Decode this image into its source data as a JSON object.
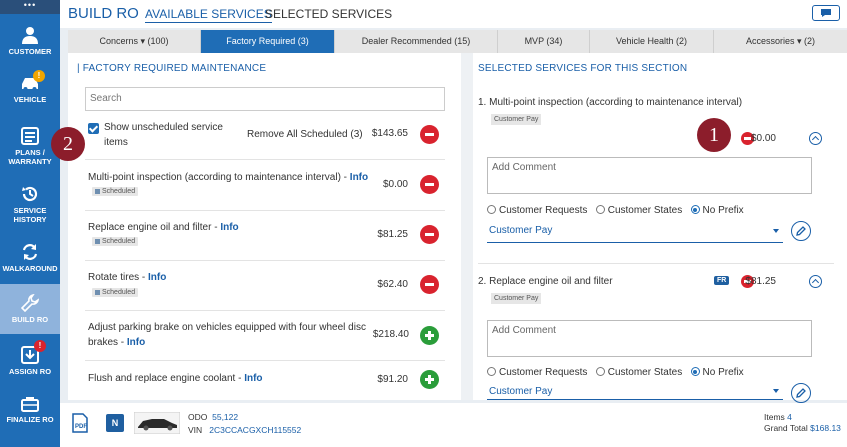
{
  "sidebar": {
    "top": "•••",
    "items": [
      {
        "label": "CUSTOMER"
      },
      {
        "label": "VEHICLE",
        "badge": "!"
      },
      {
        "label": "PLANS / WARRANTY"
      },
      {
        "label": "SERVICE HISTORY"
      },
      {
        "label": "WALKAROUND"
      },
      {
        "label": "BUILD RO"
      },
      {
        "label": "ASSIGN RO",
        "badge": "!"
      },
      {
        "label": "FINALIZE RO"
      }
    ]
  },
  "header": {
    "title": "BUILD RO",
    "tab_available": "AVAILABLE SERVICES",
    "tab_selected": "SELECTED SERVICES"
  },
  "tabs": [
    {
      "label": "Concerns ▾ (100)"
    },
    {
      "label": "Factory Required (3)"
    },
    {
      "label": "Dealer Recommended (15)"
    },
    {
      "label": "MVP (34)"
    },
    {
      "label": "Vehicle Health (2)"
    },
    {
      "label": "Accessories ▾ (2)"
    }
  ],
  "left_panel": {
    "title": "| FACTORY REQUIRED MAINTENANCE",
    "search_placeholder": "Search",
    "show_unscheduled": "Show unscheduled service items",
    "remove_all": "Remove All Scheduled (3)",
    "remove_all_price": "$143.65",
    "services": [
      {
        "name": "Multi-point inspection (according to maintenance interval) -",
        "info": "Info",
        "price": "$0.00",
        "tag": "Scheduled",
        "action": "remove"
      },
      {
        "name": "Replace engine oil and filter -",
        "info": "Info",
        "price": "$81.25",
        "tag": "Scheduled",
        "action": "remove"
      },
      {
        "name": "Rotate tires -",
        "info": "Info",
        "price": "$62.40",
        "tag": "Scheduled",
        "action": "remove"
      },
      {
        "name": "Adjust parking brake on vehicles equipped with four wheel disc brakes -",
        "info": "Info",
        "price": "$218.40",
        "tag": "",
        "action": "add"
      },
      {
        "name": "Flush and replace engine coolant -",
        "info": "Info",
        "price": "$91.20",
        "tag": "",
        "action": "add"
      }
    ]
  },
  "right_panel": {
    "title": "SELECTED SERVICES FOR THIS SECTION",
    "items": [
      {
        "title": "1.  Multi-point inspection (according to maintenance interval)",
        "pay_tag": "Customer Pay",
        "price": "$0.00",
        "comment_placeholder": "Add Comment",
        "radio_options": [
          "Customer Requests",
          "Customer States",
          "No Prefix"
        ],
        "pay_select": "Customer Pay"
      },
      {
        "title": "2.  Replace engine oil and filter",
        "badge": "FR",
        "pay_tag": "Customer Pay",
        "price": "$81.25",
        "comment_placeholder": "Add Comment",
        "radio_options": [
          "Customer Requests",
          "Customer States",
          "No Prefix"
        ],
        "pay_select": "Customer Pay"
      }
    ]
  },
  "callouts": [
    "1",
    "2"
  ],
  "footer": {
    "pdf": "PDF",
    "n_badge": "N",
    "odo_label": "ODO",
    "odo": "55,122",
    "vin_label": "VIN",
    "vin": "2C3CCACGXCH115552",
    "items_label": "Items",
    "items": "4",
    "grand_total_label": "Grand Total",
    "grand_total": "$168.13"
  },
  "colors": {
    "primary": "#1f6db6",
    "remove": "#d9232e",
    "add": "#2a9d3a",
    "callout": "#8c1d2b"
  }
}
